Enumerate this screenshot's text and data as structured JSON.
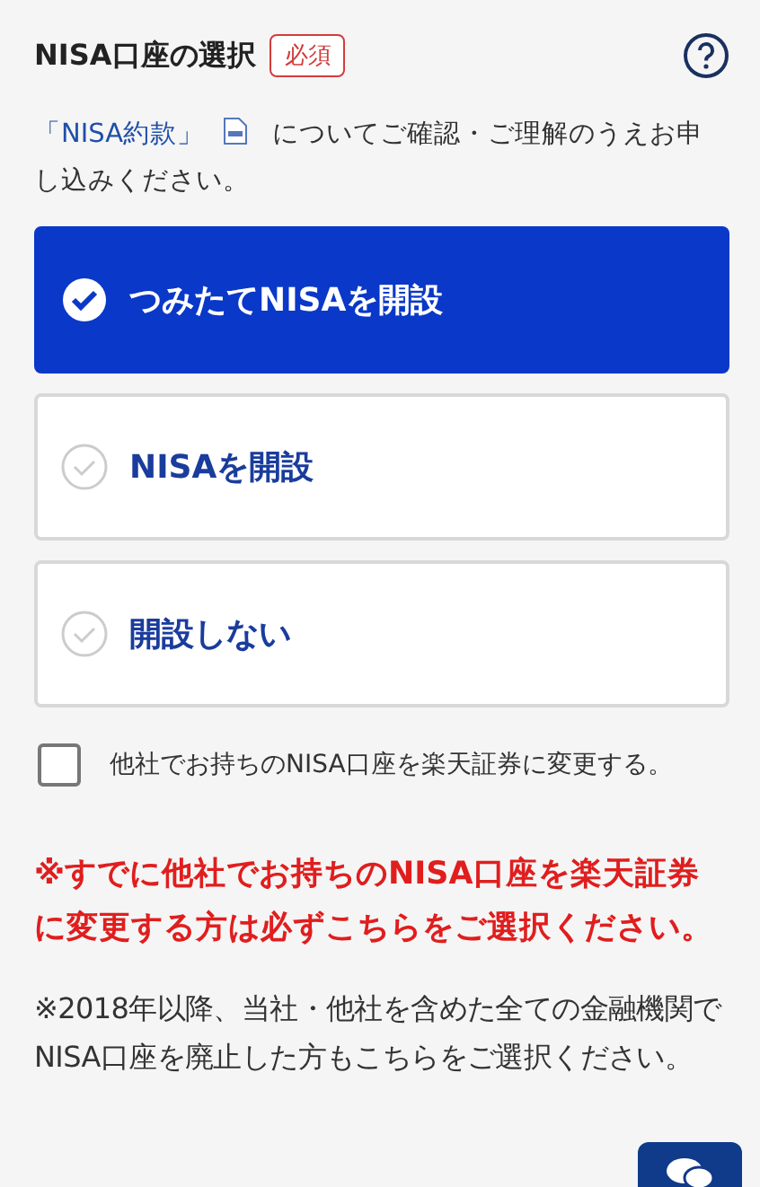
{
  "header": {
    "title": "NISA口座の選択",
    "badge": "必須"
  },
  "intro": {
    "link": "「NISA約款」",
    "text": "についてご確認・ご理解のうえお申し込みください。"
  },
  "options": [
    {
      "label": "つみたてNISAを開設",
      "selected": true
    },
    {
      "label": "NISAを開設",
      "selected": false
    },
    {
      "label": "開設しない",
      "selected": false
    }
  ],
  "transfer": {
    "label": "他社でお持ちのNISA口座を楽天証券に変更する。",
    "checked": false
  },
  "warning": "※すでに他社でお持ちのNISA口座を楽天証券に変更する方は必ずこちらをご選択ください。",
  "note": "※2018年以降、当社・他社を含めた全ての金融機関でNISA口座を廃止した方もこちらをご選択ください。"
}
